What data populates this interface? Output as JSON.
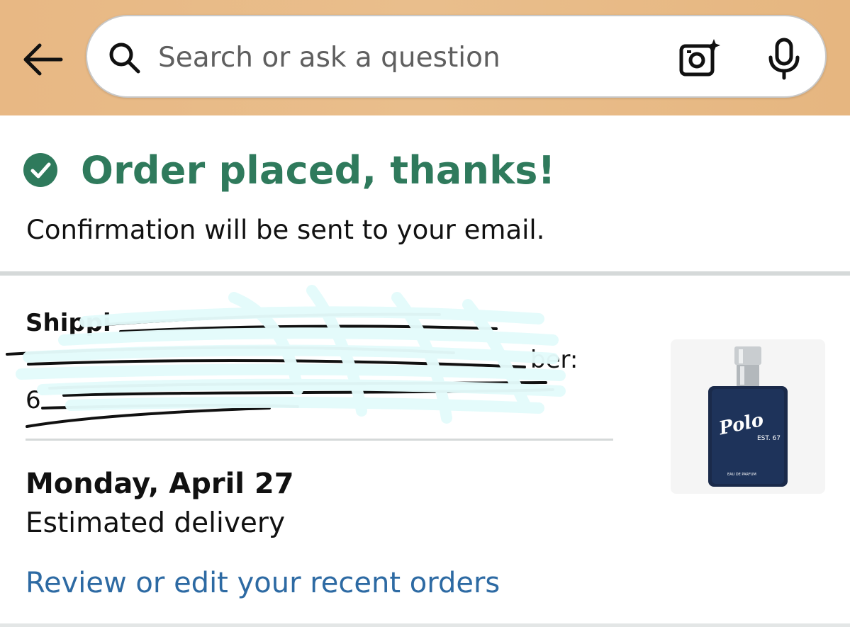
{
  "search": {
    "placeholder": "Search or ask a question"
  },
  "confirmation": {
    "title": "Order placed, thanks!",
    "subtitle": "Confirmation will be sent to your email."
  },
  "shipping": {
    "partial_line_1": "Shippi",
    "partial_line_2": "ber:",
    "partial_line_3": "6"
  },
  "delivery": {
    "date": "Monday, April 27",
    "label": "Estimated delivery"
  },
  "links": {
    "review_orders": "Review or edit your recent orders"
  },
  "product": {
    "brand_text": "Polo",
    "badge_text": "EST. 67",
    "label_text": "EAU DE PARFUM"
  },
  "colors": {
    "header_bg": "#e9be8c",
    "success_green": "#2f7a5c",
    "link_blue": "#2d6aa3",
    "divider": "#d5d9d9"
  },
  "icons": {
    "back": "back-arrow-icon",
    "search": "search-icon",
    "camera": "camera-sparkle-icon",
    "mic": "microphone-icon",
    "check": "check-circle-icon"
  }
}
